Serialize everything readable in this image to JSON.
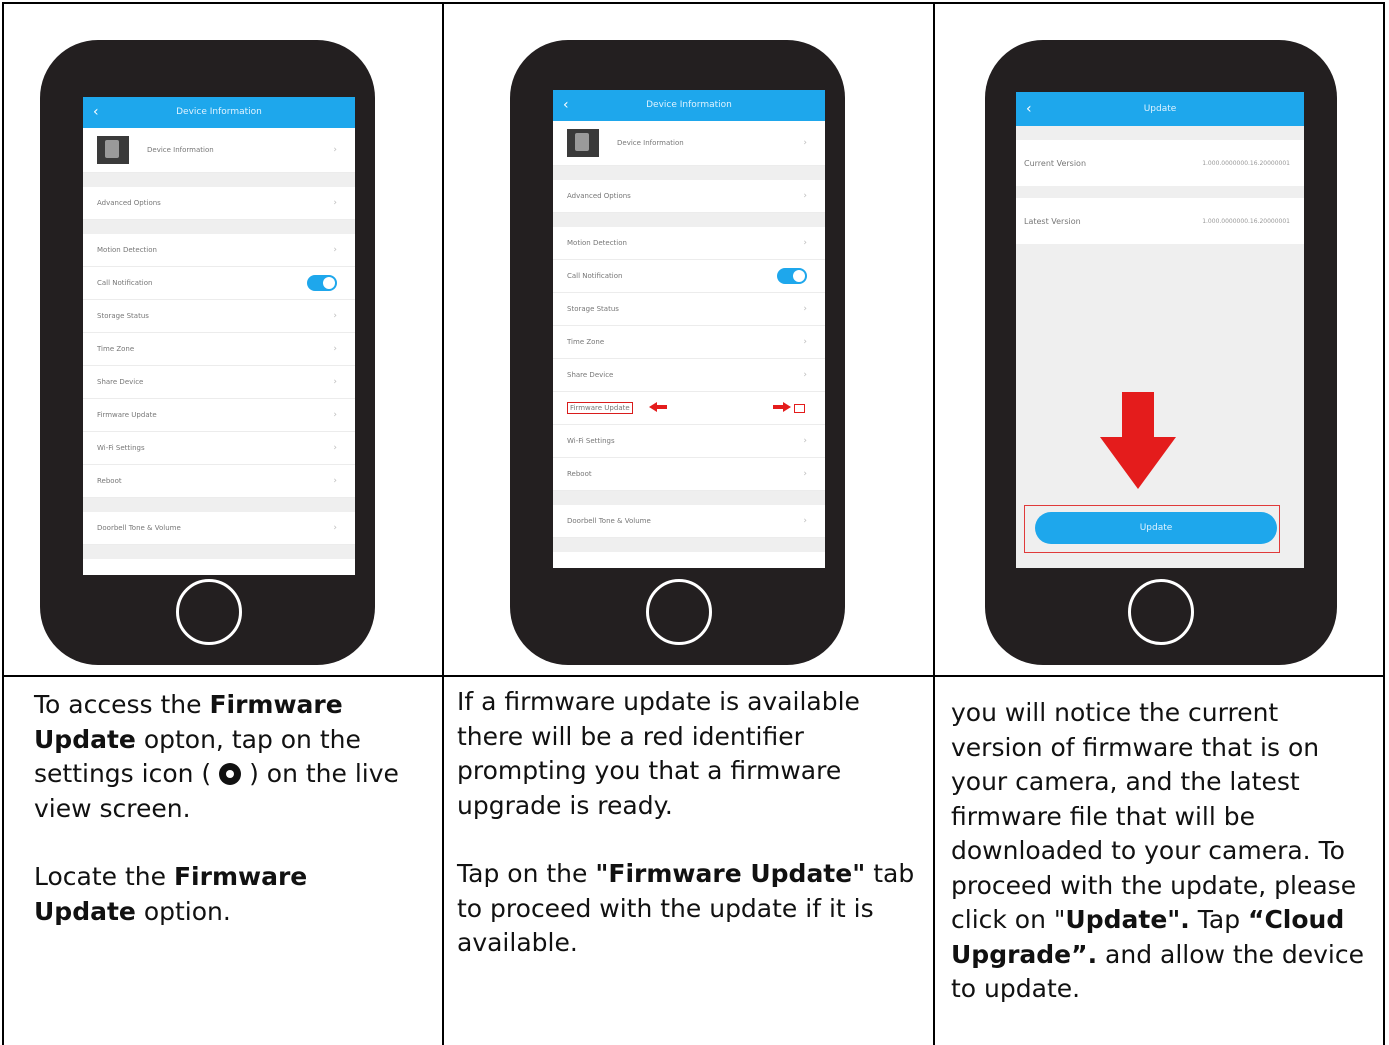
{
  "phone1": {
    "header_title": "Device Information",
    "device_row": "Device Information",
    "rows": {
      "advanced": "Advanced Options",
      "motion": "Motion Detection",
      "call": "Call Notification",
      "storage": "Storage Status",
      "timezone": "Time Zone",
      "share": "Share Device",
      "firmware": "Firmware Update",
      "wifi": "Wi-Fi Settings",
      "reboot": "Reboot",
      "doorbell": "Doorbell Tone & Volume"
    }
  },
  "phone2": {
    "header_title": "Device Information",
    "device_row": "Device Information",
    "rows": {
      "advanced": "Advanced Options",
      "motion": "Motion Detection",
      "call": "Call Notification",
      "storage": "Storage Status",
      "timezone": "Time Zone",
      "share": "Share Device",
      "firmware": "Firmware Update",
      "wifi": "Wi-Fi Settings",
      "reboot": "Reboot",
      "doorbell": "Doorbell Tone & Volume"
    }
  },
  "phone3": {
    "header_title": "Update",
    "current_label": "Current Version",
    "current_value": "1.000.0000000.16.20000001",
    "latest_label": "Latest Version",
    "latest_value": "1.000.0000000.16.20000001",
    "update_button": "Update"
  },
  "text1": {
    "p1_pre": "To access the ",
    "p1_bold": "Firmware Update",
    "p1_mid": " opton, tap on the settings icon (",
    "p1_post": ") on the live view screen.",
    "p2_pre": "Locate the ",
    "p2_bold": "Firmware Update",
    "p2_post": " option."
  },
  "text2": {
    "p1": "If a firmware update is available there will be a red identifier prompting you that a firmware upgrade is ready.",
    "p2_pre": "Tap on the ",
    "p2_bold": "\"Firmware Update\"",
    "p2_post": " tab to proceed with the update if it is available."
  },
  "text3": {
    "p1": "you will notice the current version of firmware that is on your camera, and the latest firmware file that will be downloaded to your camera. To proceed with the update, please click on \"",
    "p1_bold": "Update\".",
    "p2_pre": "Tap ",
    "p2_bold": "“Cloud Upgrade”.",
    "p2_post": " and allow the device to update."
  }
}
